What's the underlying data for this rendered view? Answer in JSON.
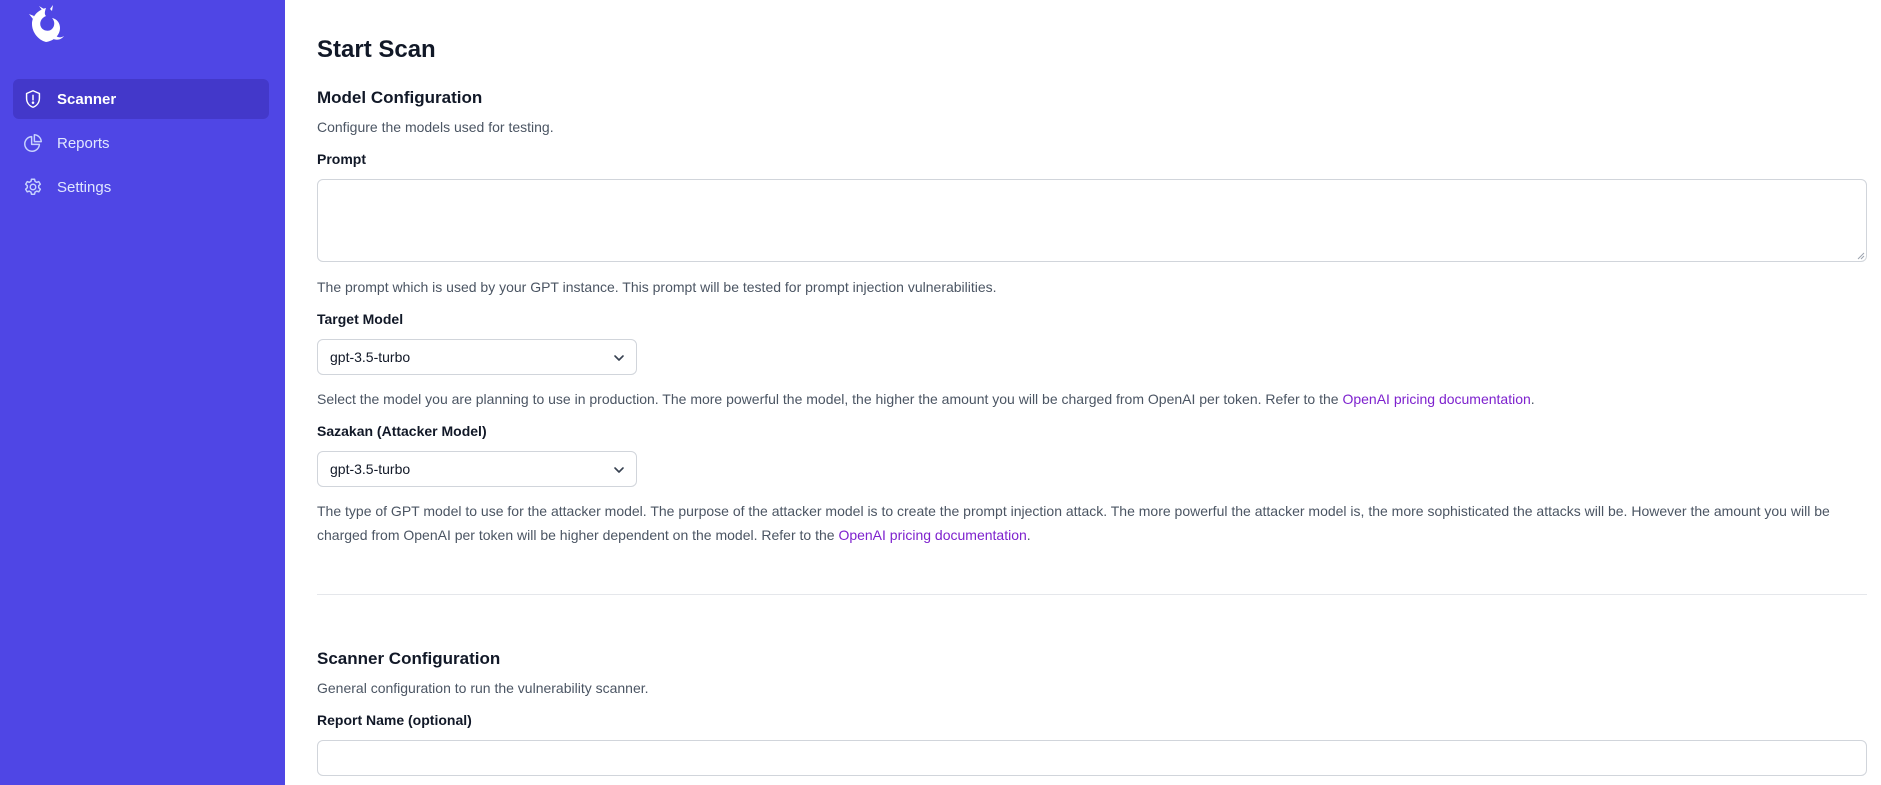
{
  "sidebar": {
    "logo_icon": "dragon-logo-icon",
    "items": [
      {
        "label": "Scanner",
        "icon": "shield-icon",
        "active": true
      },
      {
        "label": "Reports",
        "icon": "pie-chart-icon",
        "active": false
      },
      {
        "label": "Settings",
        "icon": "gear-icon",
        "active": false
      }
    ]
  },
  "main": {
    "title": "Start Scan",
    "model_config": {
      "title": "Model Configuration",
      "description": "Configure the models used for testing.",
      "prompt": {
        "label": "Prompt",
        "value": "",
        "placeholder": "",
        "help": "The prompt which is used by your GPT instance. This prompt will be tested for prompt injection vulnerabilities."
      },
      "target_model": {
        "label": "Target Model",
        "selected": "gpt-3.5-turbo",
        "help_before": "Select the model you are planning to use in production. The more powerful the model, the higher the amount you will be charged from OpenAI per token. Refer to the ",
        "link": "OpenAI pricing documentation",
        "help_after": "."
      },
      "attacker_model": {
        "label": "Sazakan (Attacker Model)",
        "selected": "gpt-3.5-turbo",
        "help_before": "The type of GPT model to use for the attacker model. The purpose of the attacker model is to create the prompt injection attack. The more powerful the attacker model is, the more sophisticated the attacks will be. However the amount you will be charged from OpenAI per token will be higher dependent on the model. Refer to the ",
        "link": "OpenAI pricing documentation",
        "help_after": "."
      }
    },
    "scanner_config": {
      "title": "Scanner Configuration",
      "description": "General configuration to run the vulnerability scanner.",
      "report_name": {
        "label": "Report Name (optional)",
        "value": "",
        "placeholder": ""
      }
    }
  },
  "colors": {
    "sidebar_bg": "#4f46e5",
    "active_item_bg": "#4338ca",
    "link": "#7e22ce"
  }
}
